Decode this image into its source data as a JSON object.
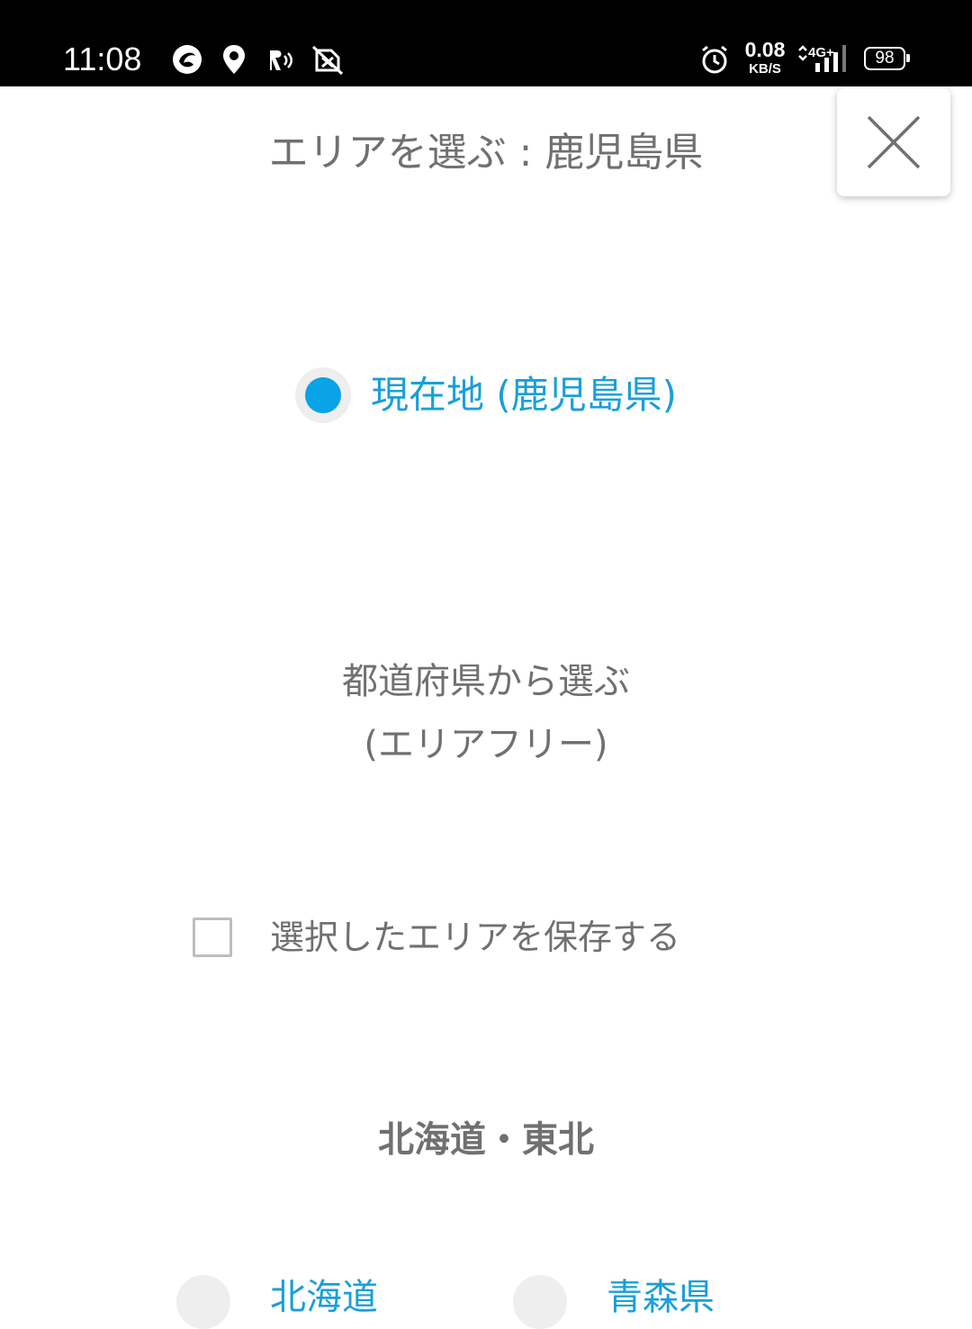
{
  "status_bar": {
    "time": "11:08",
    "speed_value": "0.08",
    "speed_unit": "KB/S",
    "network": "4G+",
    "battery": "98",
    "icons": [
      "jal-app-icon",
      "location-pin-icon",
      "rakuten-pay-icon",
      "no-wifi-icon",
      "alarm-icon",
      "signal-icon",
      "battery-icon"
    ]
  },
  "header": {
    "title": "エリアを選ぶ : 鹿児島県",
    "close_icon": "close-icon"
  },
  "current_location": {
    "label": "現在地 (鹿児島県)",
    "selected": true
  },
  "prefecture_select": {
    "line1": "都道府県から選ぶ",
    "line2": "(エリアフリー)"
  },
  "save_area": {
    "label": "選択したエリアを保存する",
    "checked": false
  },
  "regions": [
    {
      "heading": "北海道・東北",
      "prefectures": [
        {
          "label": "北海道"
        },
        {
          "label": "青森県"
        }
      ]
    }
  ],
  "colors": {
    "accent": "#0aa3e8",
    "link": "#1a9fd8",
    "text": "#707070",
    "status_bar_bg": "#000000"
  }
}
